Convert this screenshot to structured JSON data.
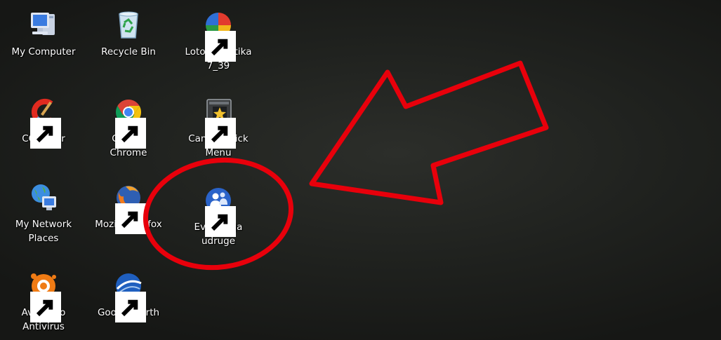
{
  "desktop": {
    "background_color": "#1f211e",
    "annotation_color": "#e8000b",
    "icons": [
      {
        "label": "My Computer",
        "icon": "my-computer-icon"
      },
      {
        "label": "Recycle Bin",
        "icon": "recycle-bin-icon"
      },
      {
        "label": "Loto statistika\n7_39",
        "icon": "loto-statistika-icon"
      },
      {
        "label": "CCleaner",
        "icon": "ccleaner-icon"
      },
      {
        "label": "Google\nChrome",
        "icon": "chrome-icon"
      },
      {
        "label": "Canon Quick\nMenu",
        "icon": "canon-quick-menu-icon"
      },
      {
        "label": "My Network\nPlaces",
        "icon": "network-places-icon"
      },
      {
        "label": "Mozilla Firefox",
        "icon": "firefox-icon"
      },
      {
        "label": "Evidencija\nudruge",
        "icon": "evidencija-udruge-icon"
      },
      {
        "label": "Avast Pro\nAntivirus",
        "icon": "avast-icon"
      },
      {
        "label": "Google Earth",
        "icon": "google-earth-icon"
      }
    ]
  }
}
